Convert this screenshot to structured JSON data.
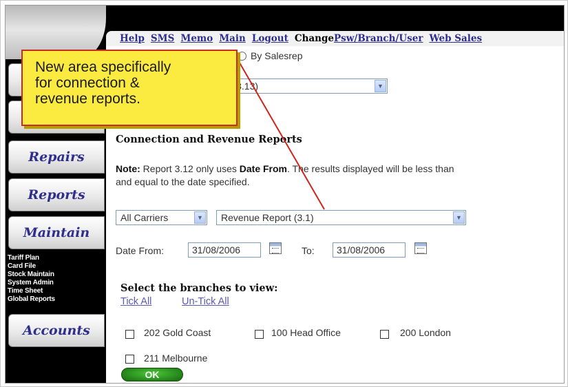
{
  "top_nav": {
    "help": "Help",
    "sms": "SMS",
    "memo": "Memo",
    "main": "Main",
    "logout": "Logout",
    "change_label": "Change",
    "psw": "Psw",
    "slash1": "/",
    "branch": "Branch",
    "slash2": "/",
    "user": "User",
    "web_sales": "Web Sales"
  },
  "sidebar": {
    "buttons": [
      "Repairs",
      "Reports",
      "Maintain",
      "Accounts"
    ],
    "maintain_submenu": [
      "Tariff Plan",
      "Card File",
      "Stock Maintain",
      "System Admin",
      "Time Sheet",
      "Global Reports"
    ]
  },
  "partial_top": {
    "radio_label": "By Salesrep",
    "select_value": "rt (3.13)"
  },
  "section": {
    "heading": "Connection and Revenue Reports",
    "note_label": "Note:",
    "note_text_1": " Report 3.12 only uses ",
    "note_bold": "Date From",
    "note_text_2": ". The results displayed will be less than",
    "note_text_3": "and equal to the date specified."
  },
  "filters": {
    "carrier_select": "All Carriers",
    "report_select": "Revenue Report (3.1)",
    "date_from_label": "Date From:",
    "date_from_value": "31/08/2006",
    "to_label": "To:",
    "date_to_value": "31/08/2006"
  },
  "branches": {
    "title": "Select the branches to view:",
    "tick_all": "Tick All",
    "untick_all": "Un-Tick All",
    "items": [
      "202 Gold Coast",
      "100 Head Office",
      "200 London",
      "211 Melbourne"
    ]
  },
  "ok_label": "OK",
  "callout": {
    "lines": [
      "New area specifically",
      "for connection &",
      "revenue reports."
    ]
  },
  "colors": {
    "callout_bg": "#fbea3f",
    "callout_border": "#cb2a20",
    "nav_text": "#2d2d8c",
    "arrow": "#d0241b"
  }
}
